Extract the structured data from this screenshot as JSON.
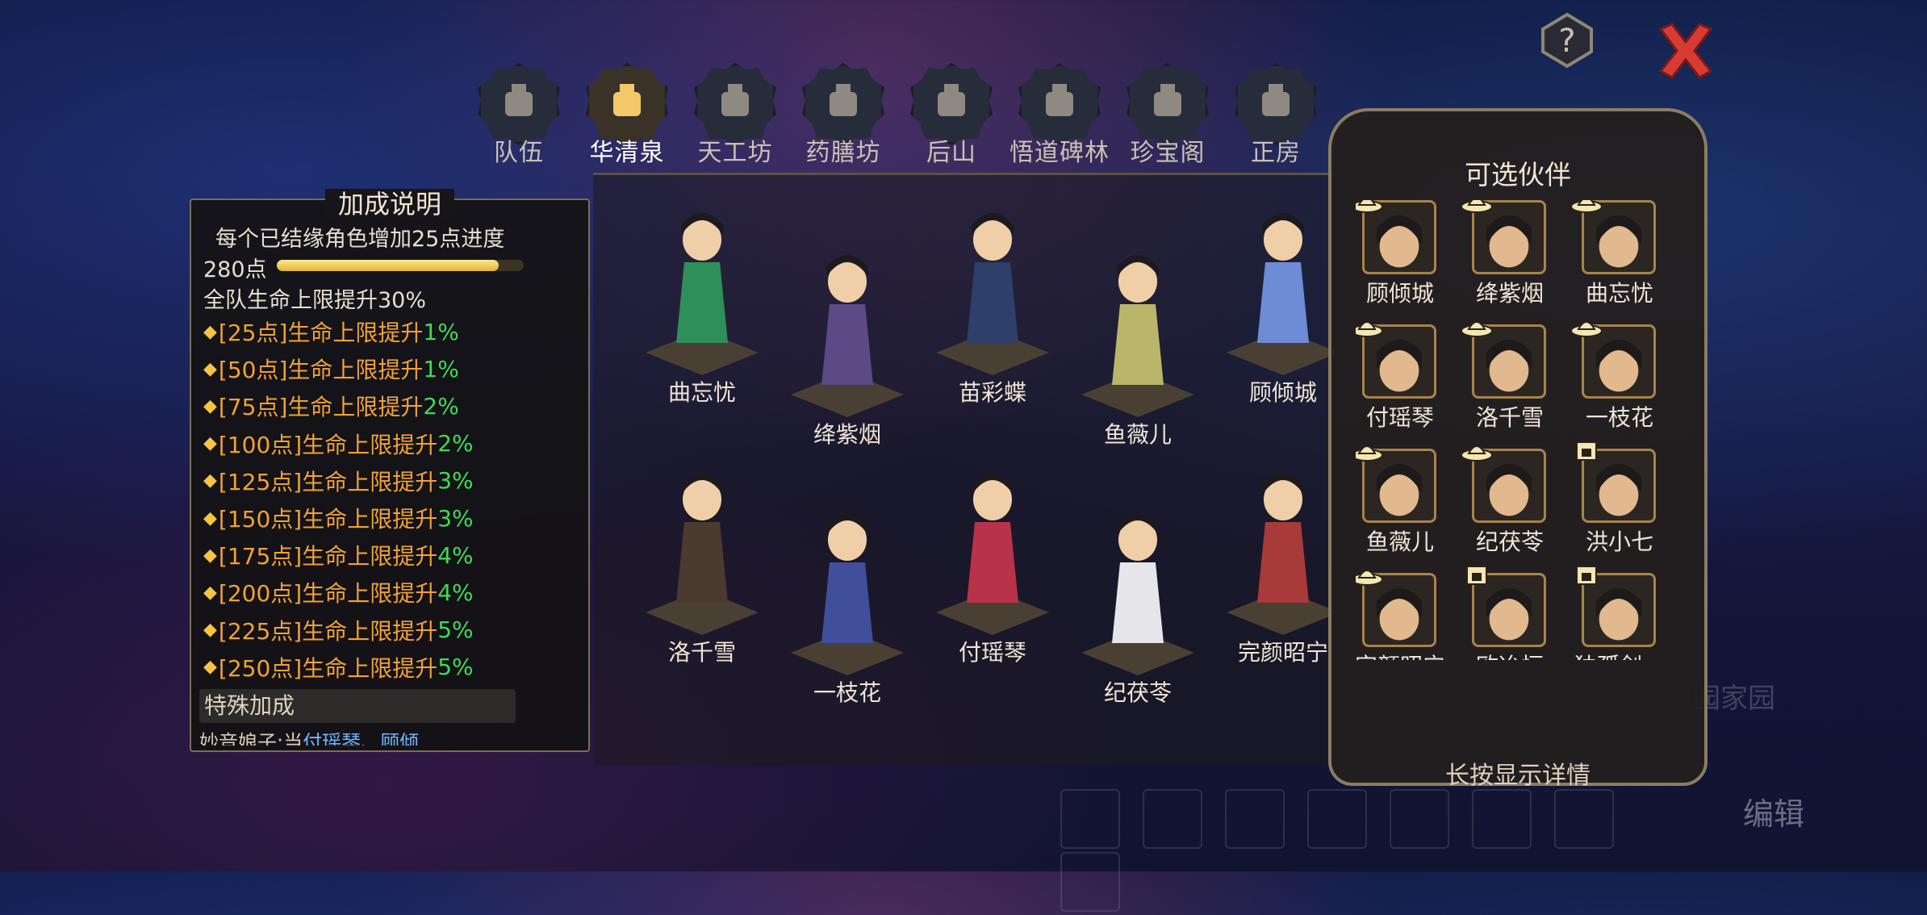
{
  "tabs": [
    {
      "label": "队伍",
      "icon": "team-icon"
    },
    {
      "label": "华清泉",
      "icon": "hot-spring-icon",
      "active": true
    },
    {
      "label": "天工坊",
      "icon": "workshop-icon"
    },
    {
      "label": "药膳坊",
      "icon": "kitchen-icon"
    },
    {
      "label": "后山",
      "icon": "mountain-icon"
    },
    {
      "label": "悟道碑林",
      "icon": "stele-icon"
    },
    {
      "label": "珍宝阁",
      "icon": "treasure-pavilion-icon"
    },
    {
      "label": "正房",
      "icon": "main-house-icon"
    }
  ],
  "bonus_panel": {
    "title": "加成说明",
    "intro": "每个已结缘角色增加25点进度",
    "points": "280点",
    "progress_fraction": 0.9,
    "team_bonus": "全队生命上限提升30%",
    "tiers": [
      {
        "threshold": "[25点]",
        "text": "生命上限提升",
        "value": "1%"
      },
      {
        "threshold": "[50点]",
        "text": "生命上限提升",
        "value": "1%"
      },
      {
        "threshold": "[75点]",
        "text": "生命上限提升",
        "value": "2%"
      },
      {
        "threshold": "[100点]",
        "text": "生命上限提升",
        "value": "2%"
      },
      {
        "threshold": "[125点]",
        "text": "生命上限提升",
        "value": "3%"
      },
      {
        "threshold": "[150点]",
        "text": "生命上限提升",
        "value": "3%"
      },
      {
        "threshold": "[175点]",
        "text": "生命上限提升",
        "value": "4%"
      },
      {
        "threshold": "[200点]",
        "text": "生命上限提升",
        "value": "4%"
      },
      {
        "threshold": "[225点]",
        "text": "生命上限提升",
        "value": "5%"
      },
      {
        "threshold": "[250点]",
        "text": "生命上限提升",
        "value": "5%"
      }
    ],
    "special_label": "特殊加成",
    "special_detail_prefix": "妙音娘子:当",
    "special_detail_hl1": "付瑶琴",
    "special_detail_mid": "、",
    "special_detail_hl2": "顾倾"
  },
  "stage_characters": [
    {
      "name": "曲忘忧",
      "color": "#2f8f5a"
    },
    {
      "name": "绛紫烟",
      "color": "#5b4a86"
    },
    {
      "name": "苗彩蝶",
      "color": "#2d3f6a"
    },
    {
      "name": "鱼薇儿",
      "color": "#b9b66a"
    },
    {
      "name": "顾倾城",
      "color": "#6e8bd6"
    },
    {
      "name": "洛千雪",
      "color": "#4a3a30"
    },
    {
      "name": "一枝花",
      "color": "#3f4f9a"
    },
    {
      "name": "付瑶琴",
      "color": "#b8334a"
    },
    {
      "name": "纪茯苓",
      "color": "#e6e6ea"
    },
    {
      "name": "完颜昭宁",
      "color": "#a83a3a"
    }
  ],
  "companions": {
    "title": "可选伙伴",
    "footer": "长按显示详情",
    "items": [
      {
        "name": "顾倾城",
        "badge": "hat-badge-icon"
      },
      {
        "name": "绛紫烟",
        "badge": "hat-badge-icon"
      },
      {
        "name": "曲忘忧",
        "badge": "hat-badge-icon"
      },
      {
        "name": "付瑶琴",
        "badge": "hat-badge-icon"
      },
      {
        "name": "洛千雪",
        "badge": "hat-badge-icon"
      },
      {
        "name": "一枝花",
        "badge": "hat-badge-icon"
      },
      {
        "name": "鱼薇儿",
        "badge": "hat-badge-icon"
      },
      {
        "name": "纪茯苓",
        "badge": "hat-badge-icon"
      },
      {
        "name": "洪小七",
        "badge": "building-badge-icon"
      },
      {
        "name": "完颜昭宁",
        "badge": "hat-badge-icon"
      },
      {
        "name": "欧冶恒",
        "badge": "building-badge-icon"
      },
      {
        "name": "独孤剑一",
        "badge": "building-badge-icon"
      },
      {
        "name": "",
        "badge": "building-badge-icon"
      },
      {
        "name": "",
        "badge": "building-badge-icon"
      },
      {
        "name": "",
        "badge": "building-badge-icon"
      }
    ]
  },
  "background": {
    "home_label": "园家园",
    "edit_label": "编辑"
  },
  "colors": {
    "accent_gold": "#f5c542",
    "tier_orange": "#f0a236",
    "tier_green": "#3ddc54",
    "close_red": "#d83a34"
  }
}
